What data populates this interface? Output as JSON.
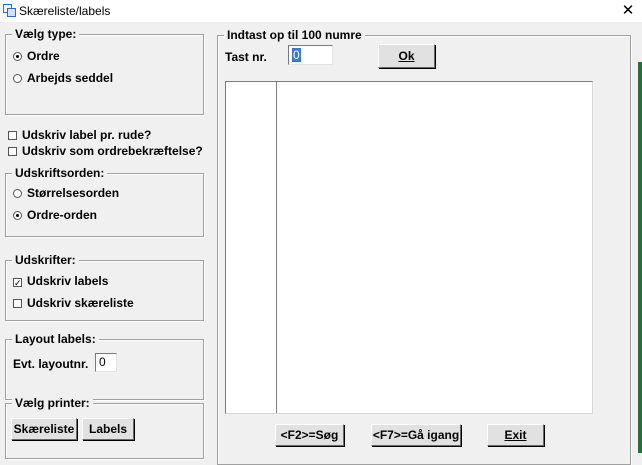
{
  "window": {
    "title": "Skæreliste/labels",
    "close_glyph": "✕"
  },
  "vaelg_type": {
    "legend": "Vælg type:",
    "options": [
      {
        "label": "Ordre",
        "checked": true
      },
      {
        "label": "Arbejds seddel",
        "checked": false
      }
    ]
  },
  "checkboxes": [
    {
      "label": "Udskriv label pr. rude?",
      "checked": false
    },
    {
      "label": "Udskriv som ordrebekræftelse?",
      "checked": false
    }
  ],
  "udskriftsorden": {
    "legend": "Udskriftsorden:",
    "options": [
      {
        "label": "Størrelsesorden",
        "checked": false
      },
      {
        "label": "Ordre-orden",
        "checked": true
      }
    ]
  },
  "udskrifter": {
    "legend": "Udskrifter:",
    "items": [
      {
        "label": "Udskriv labels",
        "checked": true
      },
      {
        "label": "Udskriv skæreliste",
        "checked": false
      }
    ]
  },
  "layout_labels": {
    "legend": "Layout labels:",
    "field_label": "Evt. layoutnr.",
    "field_value": "0"
  },
  "vaelg_printer": {
    "legend": "Vælg printer:",
    "buttons": [
      "Skæreliste",
      "Labels"
    ]
  },
  "indtast": {
    "legend": "Indtast op til 100 numre",
    "field_label": "Tast nr.",
    "field_value": "0",
    "ok_label": "Ok"
  },
  "bottom_buttons": {
    "search": "<F2>=Søg",
    "start": "<F7>=Gå igang",
    "exit": "Exit"
  }
}
